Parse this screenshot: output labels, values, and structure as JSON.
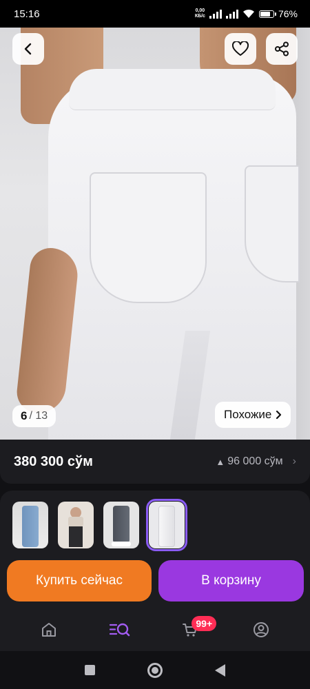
{
  "status_bar": {
    "time": "15:16",
    "net_speed_value": "0,00",
    "net_speed_unit": "КБ/с",
    "battery": "76%"
  },
  "product": {
    "image_counter": {
      "current": "6",
      "total": "/ 13"
    },
    "similar_label": "Похожие",
    "price": "380 300 сўм",
    "price_delta": "96 000 сўм"
  },
  "actions": {
    "buy_now": "Купить сейчас",
    "add_to_cart": "В корзину"
  },
  "tabbar": {
    "cart_badge": "99+"
  },
  "colors": {
    "accent_purple": "#9a38e0",
    "accent_orange": "#f07a22",
    "badge_red": "#ff2d55",
    "selected_outline": "#8b5cf6"
  },
  "icons": [
    "back-icon",
    "heart-icon",
    "share-icon",
    "home-icon",
    "catalog-search-icon",
    "cart-icon",
    "profile-icon"
  ]
}
